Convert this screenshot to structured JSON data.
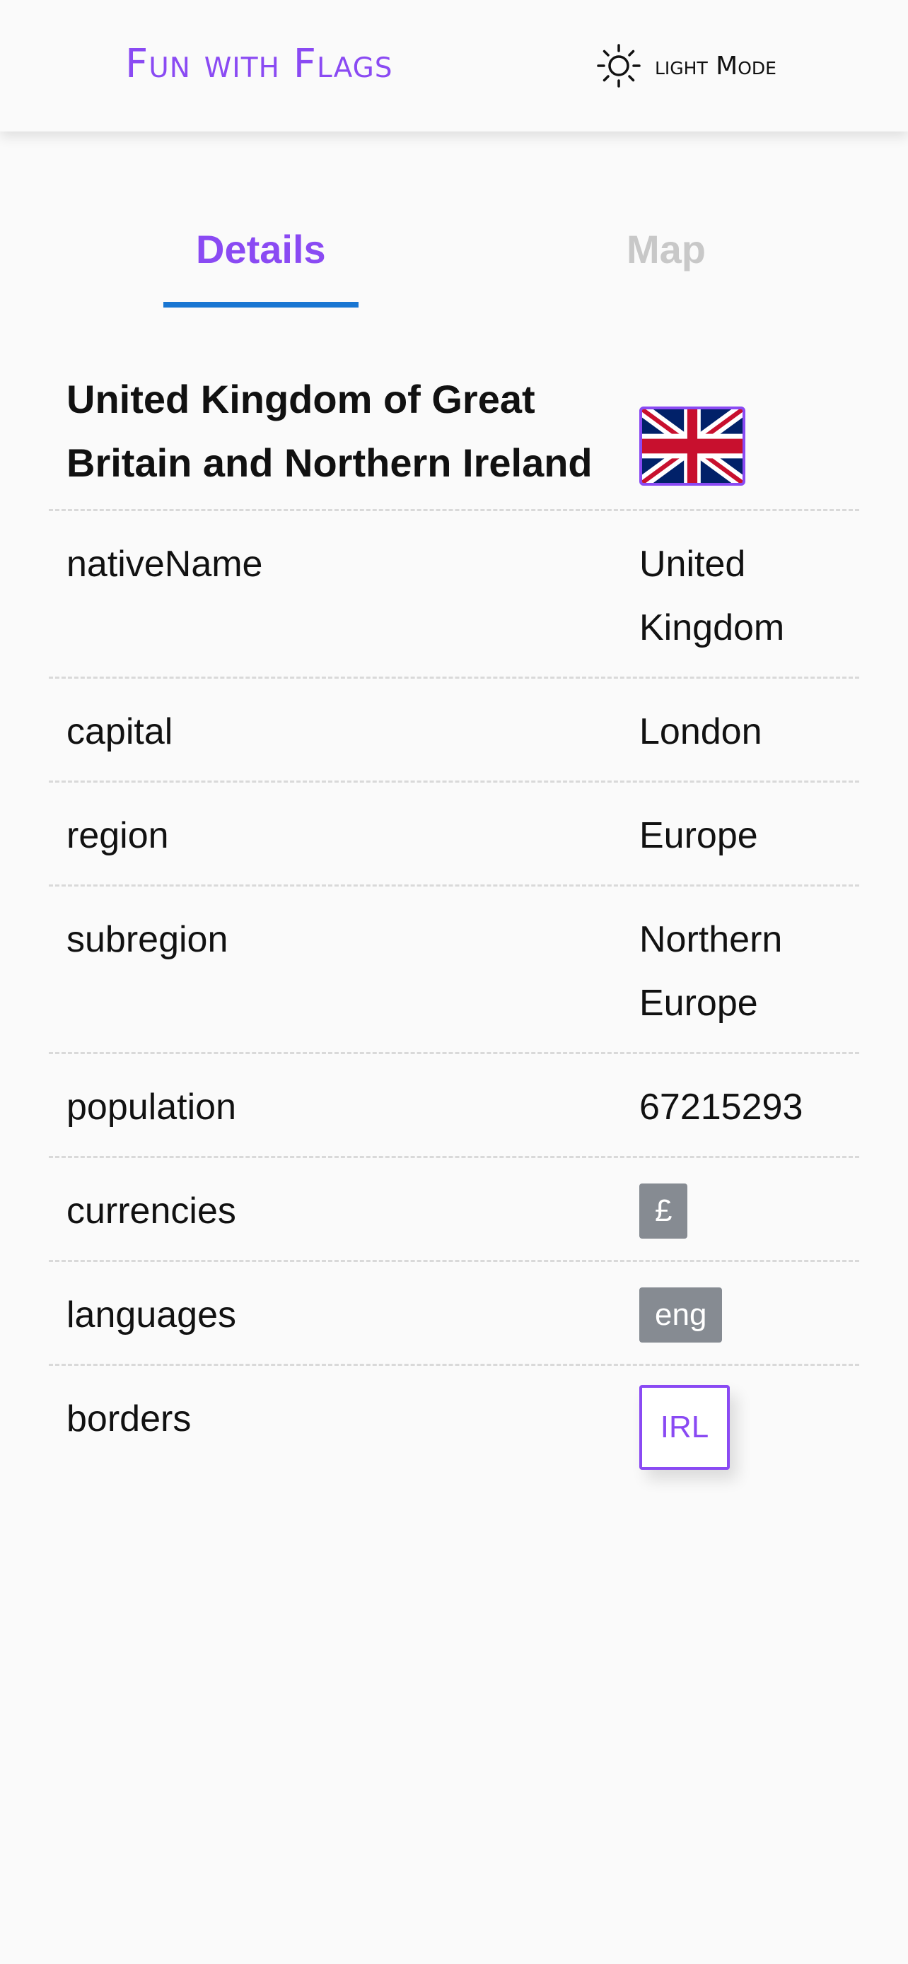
{
  "header": {
    "app_title": "Fun with Flags",
    "mode_label": "light Mode",
    "mode_icon": "sun-icon"
  },
  "tabs": [
    {
      "label": "Details",
      "active": true
    },
    {
      "label": "Map",
      "active": false
    }
  ],
  "country": {
    "name": "United Kingdom of Great Britain and Northern Ireland",
    "flag_icon": "uk-flag-icon"
  },
  "fields": {
    "nativeName": {
      "label": "nativeName",
      "value": "United Kingdom"
    },
    "capital": {
      "label": "capital",
      "value": "London"
    },
    "region": {
      "label": "region",
      "value": "Europe"
    },
    "subregion": {
      "label": "subregion",
      "value": "Northern Europe"
    },
    "population": {
      "label": "population",
      "value": "67215293"
    },
    "currencies": {
      "label": "currencies",
      "chips": [
        "£"
      ]
    },
    "languages": {
      "label": "languages",
      "chips": [
        "eng"
      ]
    },
    "borders": {
      "label": "borders",
      "buttons": [
        "IRL"
      ]
    }
  },
  "colors": {
    "accent": "#8a4af3",
    "tab_indicator": "#1976d2",
    "chip_bg": "#868b92",
    "inactive_tab": "#c8c8c8"
  }
}
